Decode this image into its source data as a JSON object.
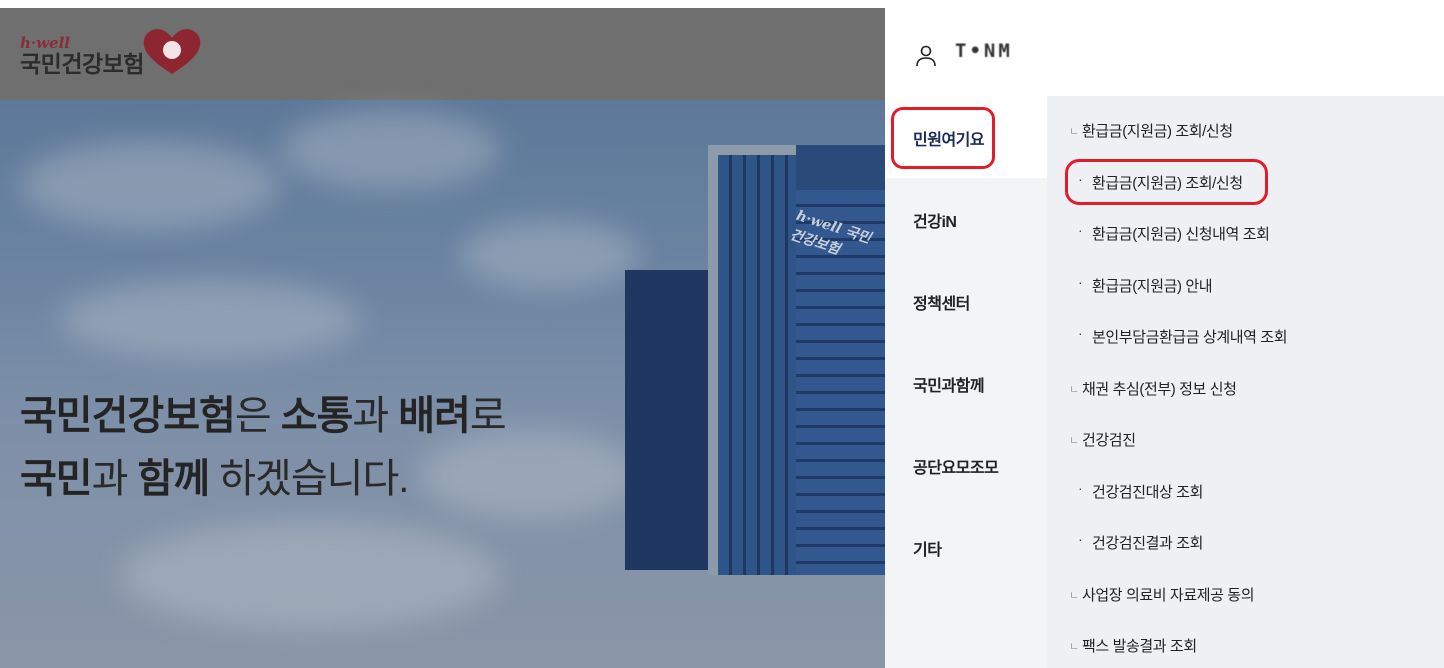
{
  "brand": {
    "small": "h·well",
    "name": "국민건강보험"
  },
  "hero": {
    "line1": [
      {
        "t": "국민건강보험",
        "b": true
      },
      {
        "t": "은 ",
        "b": false
      },
      {
        "t": "소통",
        "b": true
      },
      {
        "t": "과 ",
        "b": false
      },
      {
        "t": "배려",
        "b": true
      },
      {
        "t": "로",
        "b": false
      }
    ],
    "line2": [
      {
        "t": "국민",
        "b": true
      },
      {
        "t": "과 ",
        "b": false
      },
      {
        "t": "함께",
        "b": true
      },
      {
        "t": " 하겠습니다.",
        "b": false
      }
    ],
    "building_sign": "h·well 국민건강보험"
  },
  "user": {
    "icon": "user-icon",
    "name": "T•NM"
  },
  "categories": [
    {
      "label": "민원여기요",
      "active": true
    },
    {
      "label": "건강iN",
      "active": false
    },
    {
      "label": "정책센터",
      "active": false
    },
    {
      "label": "국민과함께",
      "active": false
    },
    {
      "label": "공단요모조모",
      "active": false
    },
    {
      "label": "기타",
      "active": false
    }
  ],
  "submenu": [
    {
      "level": 1,
      "marker": "ㄴ",
      "label": "환급금(지원금) 조회/신청"
    },
    {
      "level": 2,
      "marker": "·",
      "label": "환급금(지원금) 조회/신청"
    },
    {
      "level": 2,
      "marker": "·",
      "label": "환급금(지원금) 신청내역 조회"
    },
    {
      "level": 2,
      "marker": "·",
      "label": "환급금(지원금) 안내"
    },
    {
      "level": 2,
      "marker": "·",
      "label": "본인부담금환급금 상계내역 조회"
    },
    {
      "level": 1,
      "marker": "ㄴ",
      "label": "채권 추심(전부) 정보 신청"
    },
    {
      "level": 1,
      "marker": "ㄴ",
      "label": "건강검진"
    },
    {
      "level": 2,
      "marker": "·",
      "label": "건강검진대상 조회"
    },
    {
      "level": 2,
      "marker": "·",
      "label": "건강검진결과 조회"
    },
    {
      "level": 1,
      "marker": "ㄴ",
      "label": "사업장 의료비 자료제공 동의"
    },
    {
      "level": 1,
      "marker": "ㄴ",
      "label": "팩스 발송결과 조회"
    }
  ],
  "colors": {
    "highlight": "#e21d2b",
    "panel_bg": "#eef0f4",
    "category_bg": "#f3f4f6"
  }
}
